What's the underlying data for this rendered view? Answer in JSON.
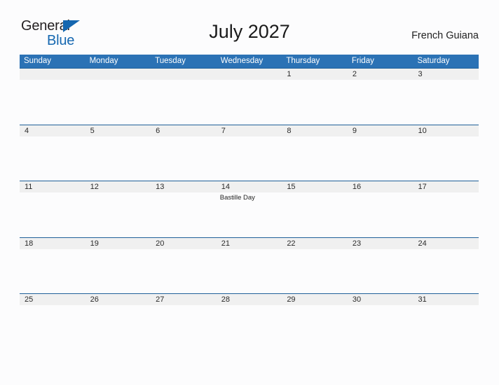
{
  "brand": {
    "word1": "General",
    "word2": "Blue",
    "triangle_icon": "triangle-right-icon",
    "color_dark": "#231f20",
    "color_blue": "#1567b0"
  },
  "header": {
    "title": "July 2027",
    "region": "French Guiana"
  },
  "theme": {
    "header_blue": "#2b72b5",
    "rule_blue": "#1f6099",
    "band_gray": "#f0f0f0",
    "page_bg": "#fcfcfd"
  },
  "calendar": {
    "weekdays": [
      "Sunday",
      "Monday",
      "Tuesday",
      "Wednesday",
      "Thursday",
      "Friday",
      "Saturday"
    ],
    "weeks": [
      [
        {
          "day": "",
          "event": ""
        },
        {
          "day": "",
          "event": ""
        },
        {
          "day": "",
          "event": ""
        },
        {
          "day": "",
          "event": ""
        },
        {
          "day": "1",
          "event": ""
        },
        {
          "day": "2",
          "event": ""
        },
        {
          "day": "3",
          "event": ""
        }
      ],
      [
        {
          "day": "4",
          "event": ""
        },
        {
          "day": "5",
          "event": ""
        },
        {
          "day": "6",
          "event": ""
        },
        {
          "day": "7",
          "event": ""
        },
        {
          "day": "8",
          "event": ""
        },
        {
          "day": "9",
          "event": ""
        },
        {
          "day": "10",
          "event": ""
        }
      ],
      [
        {
          "day": "11",
          "event": ""
        },
        {
          "day": "12",
          "event": ""
        },
        {
          "day": "13",
          "event": ""
        },
        {
          "day": "14",
          "event": "Bastille Day"
        },
        {
          "day": "15",
          "event": ""
        },
        {
          "day": "16",
          "event": ""
        },
        {
          "day": "17",
          "event": ""
        }
      ],
      [
        {
          "day": "18",
          "event": ""
        },
        {
          "day": "19",
          "event": ""
        },
        {
          "day": "20",
          "event": ""
        },
        {
          "day": "21",
          "event": ""
        },
        {
          "day": "22",
          "event": ""
        },
        {
          "day": "23",
          "event": ""
        },
        {
          "day": "24",
          "event": ""
        }
      ],
      [
        {
          "day": "25",
          "event": ""
        },
        {
          "day": "26",
          "event": ""
        },
        {
          "day": "27",
          "event": ""
        },
        {
          "day": "28",
          "event": ""
        },
        {
          "day": "29",
          "event": ""
        },
        {
          "day": "30",
          "event": ""
        },
        {
          "day": "31",
          "event": ""
        }
      ]
    ]
  }
}
